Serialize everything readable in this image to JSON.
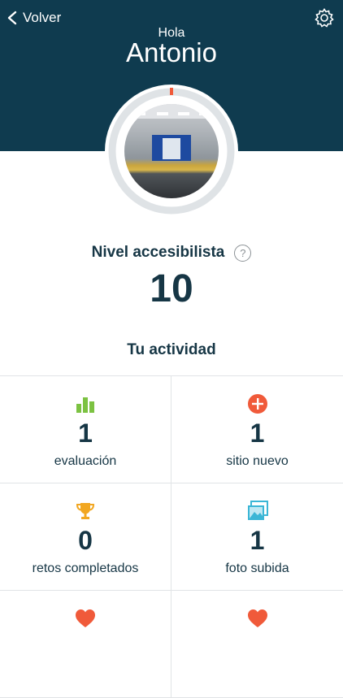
{
  "header": {
    "back_label": "Volver",
    "greeting": "Hola",
    "user_name": "Antonio",
    "background_color": "#0f3b4f",
    "settings_icon": "gear-icon"
  },
  "profile": {
    "avatar_description_icon": "subway-station-photo",
    "progress_fraction": 0.0,
    "ring_color": "#dfe3e6",
    "progress_color": "#f05a3a"
  },
  "level": {
    "label": "Nivel accesibilista",
    "value": "10",
    "help_icon": "question-icon"
  },
  "activity": {
    "title": "Tu actividad",
    "items": [
      {
        "count": "1",
        "label": "evaluación",
        "icon": "bar-chart-icon",
        "icon_color": "#7cc242"
      },
      {
        "count": "1",
        "label": "sitio nuevo",
        "icon": "plus-circle-icon",
        "icon_color": "#f05a3a"
      },
      {
        "count": "0",
        "label": "retos completados",
        "icon": "trophy-icon",
        "icon_color": "#f2a721"
      },
      {
        "count": "1",
        "label": "foto subida",
        "icon": "photos-icon",
        "icon_color": "#3bb6d6"
      },
      {
        "count": "",
        "label": "",
        "icon": "heart-icon",
        "icon_color": "#f05a3a"
      },
      {
        "count": "",
        "label": "",
        "icon": "heart-icon",
        "icon_color": "#f05a3a"
      }
    ]
  }
}
